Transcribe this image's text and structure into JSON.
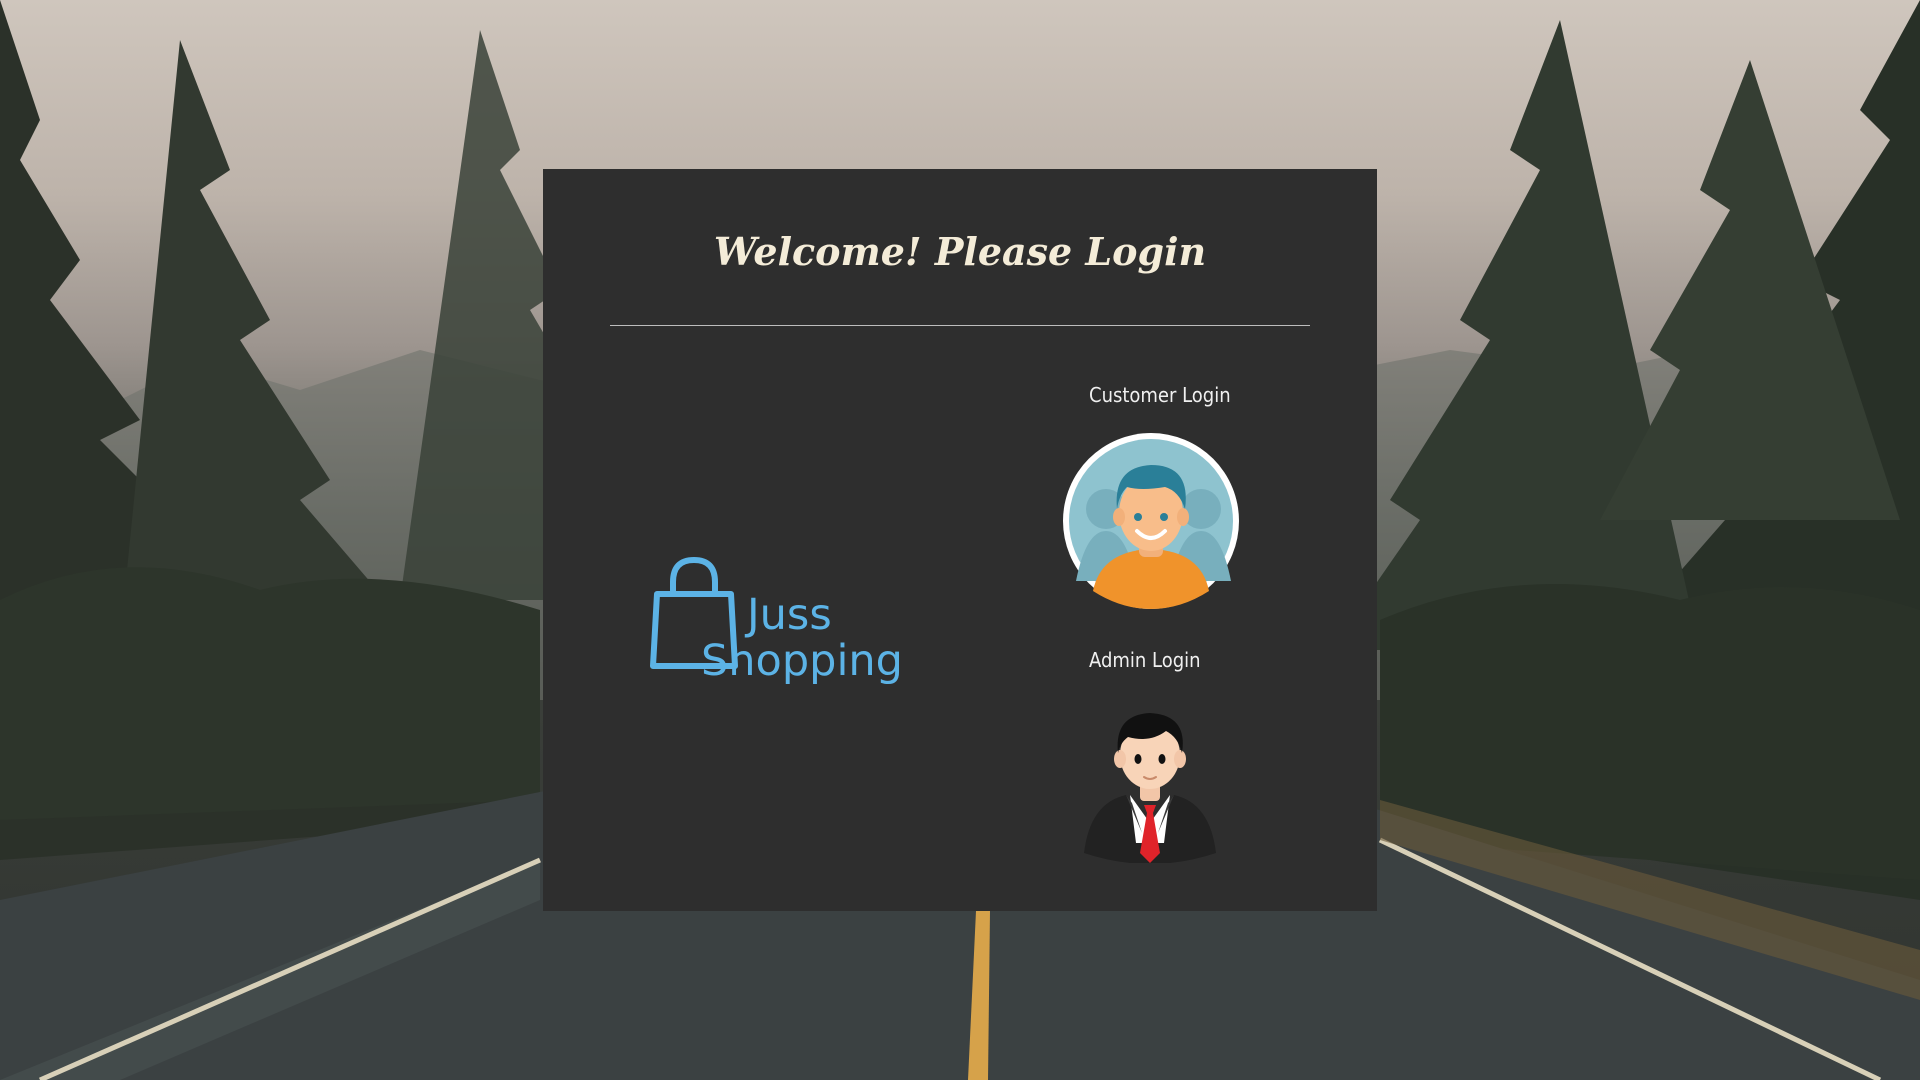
{
  "header": {
    "title": "Welcome! Please Login"
  },
  "brand": {
    "line1": "Juss",
    "line2": "Shopping",
    "icon": "shopping-bag-icon",
    "color": "#5cb3e6"
  },
  "logins": {
    "customer_label": "Customer Login",
    "customer_icon": "customer-avatar-icon",
    "admin_label": "Admin Login",
    "admin_icon": "admin-avatar-icon"
  },
  "colors": {
    "panel": "#2e2e2e",
    "title": "#f4ecd8"
  }
}
